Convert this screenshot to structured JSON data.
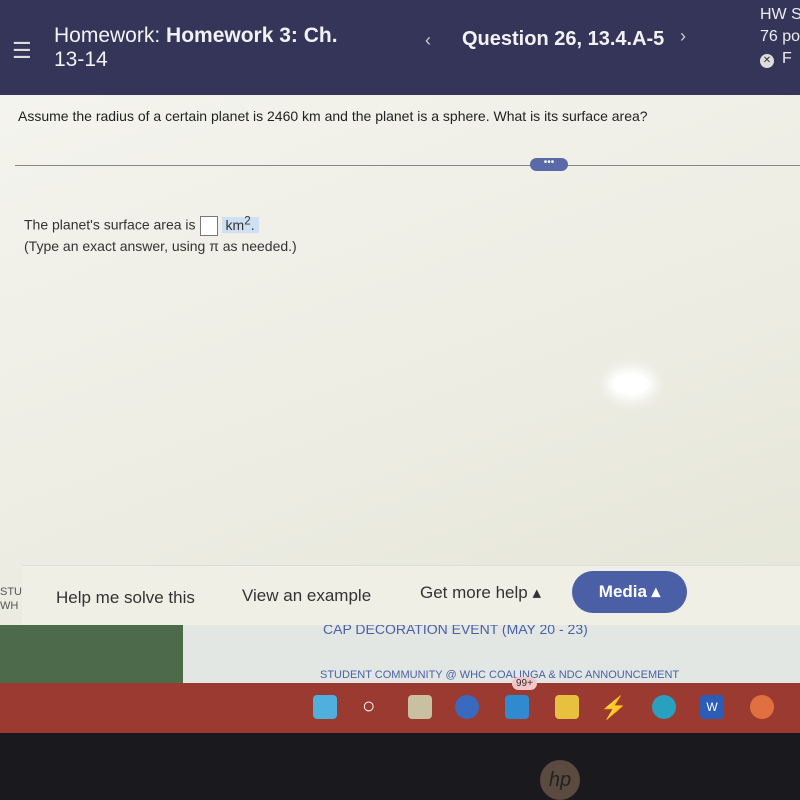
{
  "header": {
    "menu_icon": "hamburger-icon",
    "title_prefix": "Homework:",
    "title_bold": "Homework 3: Ch.",
    "title_line2": "13-14",
    "prev": "‹",
    "question": "Question 26, 13.4.A-5",
    "next": "›",
    "hw_score": "HW S",
    "points": "76 po",
    "status": "F"
  },
  "question": {
    "text": "Assume the radius of a certain planet is 2460 km and the planet is a sphere. What is its surface area?",
    "more": "•••"
  },
  "answer": {
    "prefix": "The planet's surface area is",
    "unit": "km",
    "exponent": "2",
    "suffix": ".",
    "hint": "(Type an exact answer, using π as needed.)"
  },
  "helpbar": {
    "help": "Help me solve this",
    "example": "View an example",
    "more_help": "Get more help ▴",
    "media": "Media ▴"
  },
  "side": {
    "a": "STU",
    "b": "WH"
  },
  "background": {
    "event": "CAP DECORATION EVENT (MAY 20 - 23)",
    "announcement": "STUDENT COMMUNITY @ WHC COALINGA & NDC ANNOUNCEMENT"
  },
  "taskbar": {
    "notif": "99+",
    "colors": {
      "bar": "#9a3a30",
      "media": "#4a5fa5"
    }
  },
  "laptop_logo": "hp"
}
